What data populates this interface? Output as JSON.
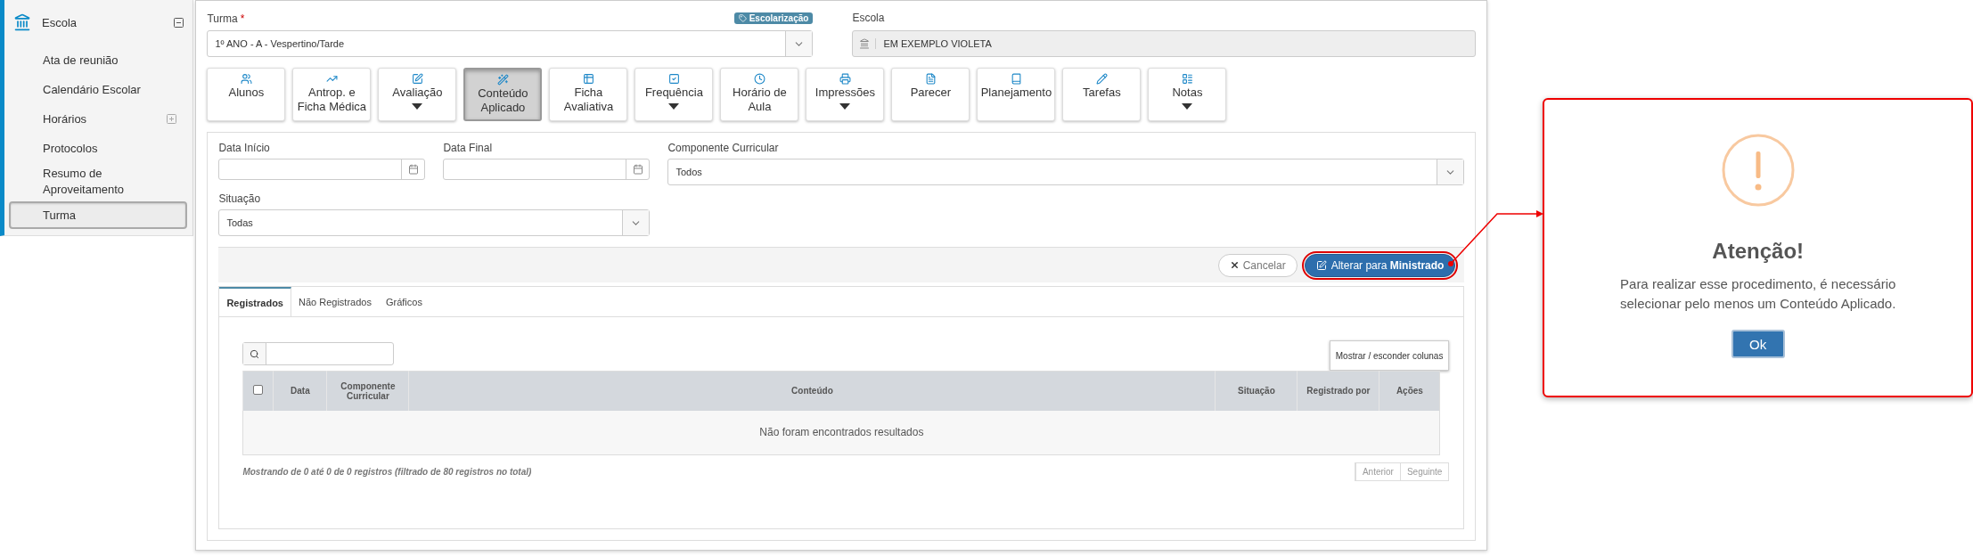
{
  "sidebar": {
    "section": {
      "label": "Escola",
      "expanded": true,
      "children": [
        {
          "label": "Ata de reunião",
          "selected": false
        },
        {
          "label": "Calendário Escolar",
          "selected": false
        },
        {
          "label": "Horários",
          "selected": false,
          "expanded": false
        },
        {
          "label": "Protocolos",
          "selected": false
        },
        {
          "label": "Resumo de Aproveitamento",
          "selected": false
        },
        {
          "label": "Turma",
          "selected": true
        }
      ]
    }
  },
  "form": {
    "turma": {
      "label": "Turma",
      "required_mark": "*",
      "value": "1º ANO - A - Vespertino/Tarde",
      "badge": "Escolarização"
    },
    "escola": {
      "label": "Escola",
      "value": "EM EXEMPLO VIOLETA"
    }
  },
  "modules": [
    {
      "label": "Alunos",
      "dropdown": false,
      "selected": false
    },
    {
      "label": "Antrop. e Ficha Médica",
      "dropdown": false,
      "selected": false
    },
    {
      "label": "Avaliação",
      "dropdown": true,
      "selected": false
    },
    {
      "label": "Conteúdo Aplicado",
      "dropdown": false,
      "selected": true
    },
    {
      "label": "Ficha Avaliativa",
      "dropdown": false,
      "selected": false
    },
    {
      "label": "Frequência",
      "dropdown": true,
      "selected": false
    },
    {
      "label": "Horário de Aula",
      "dropdown": false,
      "selected": false
    },
    {
      "label": "Impressões",
      "dropdown": true,
      "selected": false
    },
    {
      "label": "Parecer",
      "dropdown": false,
      "selected": false
    },
    {
      "label": "Planejamento",
      "dropdown": false,
      "selected": false
    },
    {
      "label": "Tarefas",
      "dropdown": false,
      "selected": false
    },
    {
      "label": "Notas",
      "dropdown": true,
      "selected": false
    }
  ],
  "filters": [
    {
      "kind": "date",
      "label": "Data Início"
    },
    {
      "kind": "date",
      "label": "Data Final"
    },
    {
      "kind": "select",
      "label": "Componente Curricular",
      "value": "Todos"
    },
    {
      "kind": "select",
      "label": "Situação",
      "value": "Todas"
    }
  ],
  "actions": {
    "cancel": "Cancelar",
    "apply": {
      "label": "Alterar para **Ministrado**",
      "highlighted": true
    }
  },
  "tabs": [
    {
      "label": "Registrados",
      "selected": true
    },
    {
      "label": "Não Registrados",
      "selected": false
    },
    {
      "label": "Gráficos",
      "selected": false
    }
  ],
  "table": {
    "toggle_columns": "Mostrar / esconder colunas",
    "select_all": {
      "checked": false
    },
    "columns": [
      "Data",
      "Componente Curricular",
      "Conteúdo",
      "Situação",
      "Registrado por",
      "Ações"
    ],
    "empty": "Não foram encontrados resultados",
    "info": "Mostrando de 0 até 0 de 0 registros (filtrado de 80 registros no total)",
    "pagination": [
      {
        "label": "Anterior",
        "disabled": true
      },
      {
        "label": "Seguinte",
        "disabled": true
      }
    ]
  },
  "dialog": {
    "title": "Atenção!",
    "message": "Para realizar esse procedimento, é necessário selecionar pelo menos um Conteúdo Aplicado.",
    "button": "Ok",
    "highlighted": true
  }
}
